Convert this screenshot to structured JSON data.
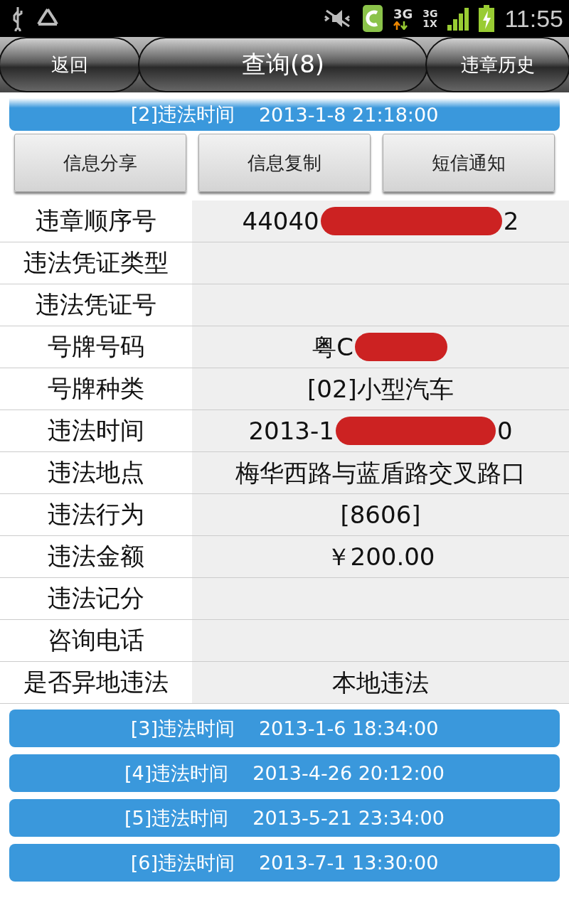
{
  "status_bar": {
    "network": "3G",
    "network_2": "3G",
    "network_3": "1X",
    "time": "11:55"
  },
  "nav_bar": {
    "back": "返回",
    "title": "查询(8)",
    "history": "违章历史"
  },
  "current_record": {
    "index": "[2]违法时间",
    "time": "2013-1-8 21:18:00",
    "expanded": true
  },
  "actions": [
    "信息分享",
    "信息复制",
    "短信通知"
  ],
  "details": [
    {
      "label": "违章顺序号",
      "value": [
        {
          "kind": "text",
          "text": "44040"
        },
        {
          "kind": "redaction"
        },
        {
          "kind": "text",
          "text": "2"
        }
      ]
    },
    {
      "label": "违法凭证类型"
    },
    {
      "label": "违法凭证号"
    },
    {
      "label": "号牌号码",
      "value": [
        {
          "kind": "text",
          "text": "粤C"
        },
        {
          "kind": "redaction"
        }
      ]
    },
    {
      "label": "号牌种类",
      "value": [
        {
          "kind": "text",
          "text": "[02]小型汽车"
        }
      ]
    },
    {
      "label": "违法时间",
      "value": [
        {
          "kind": "text",
          "text": "2013-1"
        },
        {
          "kind": "redaction"
        },
        {
          "kind": "text",
          "text": "0"
        }
      ]
    },
    {
      "label": "违法地点",
      "value": [
        {
          "kind": "text",
          "text": "梅华西路与蓝盾路交叉路口"
        }
      ]
    },
    {
      "label": "违法行为",
      "value": [
        {
          "kind": "text",
          "text": "[8606]"
        }
      ]
    },
    {
      "label": "违法金额",
      "value": [
        {
          "kind": "text",
          "text": "￥200.00"
        }
      ]
    },
    {
      "label": "违法记分"
    },
    {
      "label": "咨询电话"
    },
    {
      "label": "是否异地违法",
      "value": [
        {
          "kind": "text",
          "text": "本地违法"
        }
      ]
    }
  ],
  "other_records": [
    {
      "index": "[3]违法时间",
      "time": "2013-1-6 18:34:00",
      "expanded": false
    },
    {
      "index": "[4]违法时间",
      "time": "2013-4-26 20:12:00",
      "expanded": false
    },
    {
      "index": "[5]违法时间",
      "time": "2013-5-21 23:34:00",
      "expanded": false
    },
    {
      "index": "[6]违法时间",
      "time": "2013-7-1 13:30:00",
      "expanded": false
    }
  ]
}
